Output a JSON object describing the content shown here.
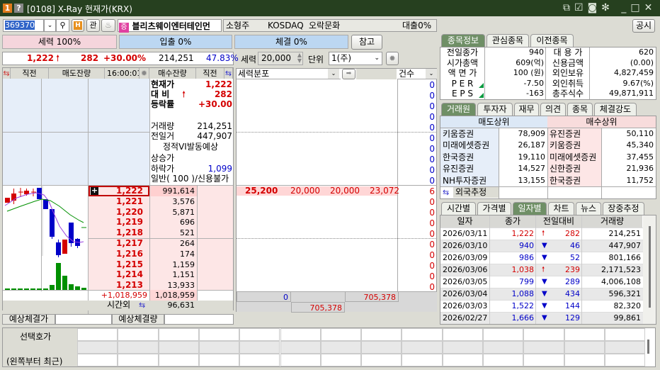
{
  "window": {
    "badge": "1",
    "help": "?",
    "title": "[0108] X-Ray 현재가(KRX)",
    "colors": {
      "titlebar": "#26401f"
    }
  },
  "toolbar": {
    "code": "369370",
    "h_label": "H",
    "watch_label": "관",
    "name_badge": "증",
    "stock_name": "블리츠웨이엔터테인먼",
    "size": "소형주",
    "market": "KOSDAQ",
    "sector": "오락문화",
    "loan": "대출0%",
    "notice": "공시"
  },
  "ratios": {
    "force": "세력 100%",
    "inout": "입출 0%",
    "trade": "체결 0%",
    "ref": "참고"
  },
  "quote": {
    "price": "1,222",
    "change": "282",
    "rate": "+30.00%",
    "volume": "214,251",
    "ratio": "47.83%"
  },
  "force_ctrl": {
    "label": "세력",
    "value": "20,000",
    "unit_label": "단위",
    "unit": "1(주)"
  },
  "orderbook": {
    "headers": {
      "prev": "직전",
      "ask_qty": "매도잔량",
      "time": "16:00:01",
      "bid_qty": "매수잔량",
      "prev2": "직전"
    },
    "info": {
      "cur_label": "현재가",
      "cur": "1,222",
      "diff_label": "대 비",
      "diff": "282",
      "rate_label": "등락률",
      "rate": "+30.00",
      "vol_label": "거래량",
      "vol": "214,251",
      "prevvol_label": "전일거",
      "prevvol": "447,907",
      "vi": "정적VI발동예상",
      "up_label": "상승가",
      "down_label": "하락가",
      "down": "1,099",
      "credit": "일반( 100 )/신용불가"
    },
    "bids": [
      {
        "price": "1,222",
        "qty": "991,614"
      },
      {
        "price": "1,221",
        "qty": "3,576"
      },
      {
        "price": "1,220",
        "qty": "5,871"
      },
      {
        "price": "1,219",
        "qty": "696"
      },
      {
        "price": "1,218",
        "qty": "521"
      },
      {
        "price": "1,217",
        "qty": "264"
      },
      {
        "price": "1,216",
        "qty": "174"
      },
      {
        "price": "1,215",
        "qty": "1,159"
      },
      {
        "price": "1,214",
        "qty": "1,151"
      },
      {
        "price": "1,213",
        "qty": "13,933"
      }
    ],
    "total_change": "+1,018,959",
    "total_bid": "1,018,959",
    "after_label": "시간외",
    "after_qty": "96,631"
  },
  "expected": {
    "price_label": "예상체결가",
    "qty_label": "예상체결량"
  },
  "distribution": {
    "select": "세력분포",
    "count_label": "건수",
    "counts_top": [
      "0",
      "0",
      "0",
      "0",
      "0",
      "0",
      "0",
      "0",
      "0",
      "0"
    ],
    "row": {
      "price": "25,200",
      "a": "20,000",
      "b": "20,000",
      "c": "23,072"
    },
    "counts_bottom": [
      "6",
      "0",
      "0",
      "0",
      "0",
      "0",
      "0",
      "0",
      "0",
      "0"
    ],
    "footer_left": "0",
    "footer_right": "705,378",
    "footer_mid": "705,378"
  },
  "stock_tabs": [
    "종목정보",
    "관심종목",
    "이전종목"
  ],
  "stock_info": [
    {
      "l1": "전일종가",
      "v1": "940",
      "l2": "대 용 가",
      "v2": "620"
    },
    {
      "l1": "시가총액",
      "v1": "609(억)",
      "l2": "신용금액",
      "v2": "(0.00)"
    },
    {
      "l1": "액 면 가",
      "v1": "100 (원)",
      "l2": "외인보유",
      "v2": "4,827,459"
    },
    {
      "l1": "P E R",
      "v1": "-7.50",
      "l2": "외인취득",
      "v2": "9.67(%)"
    },
    {
      "l1": "E P S",
      "v1": "-163",
      "l2": "총주식수",
      "v2": "49,871,911"
    }
  ],
  "broker_tabs": [
    "거래원",
    "투자자",
    "재무",
    "의견",
    "종목",
    "체결강도"
  ],
  "brokers": {
    "sell_header": "매도상위",
    "buy_header": "매수상위",
    "rows": [
      {
        "s": "키움증권",
        "sq": "78,909",
        "b": "유진증권",
        "bq": "50,110"
      },
      {
        "s": "미래에셋증권",
        "sq": "26,187",
        "b": "키움증권",
        "bq": "45,340"
      },
      {
        "s": "한국증권",
        "sq": "19,110",
        "b": "미래에셋증권",
        "bq": "37,455"
      },
      {
        "s": "유진증권",
        "sq": "14,527",
        "b": "신한증권",
        "bq": "21,936"
      },
      {
        "s": "NH투자증권",
        "sq": "13,155",
        "b": "한국증권",
        "bq": "11,752"
      }
    ],
    "foreign": "외국추정"
  },
  "daily_tabs": [
    "시간별",
    "가격별",
    "일자별",
    "차트",
    "뉴스",
    "장중추정"
  ],
  "daily": {
    "headers": [
      "일자",
      "종가",
      "전일대비",
      "거래량"
    ],
    "rows": [
      {
        "date": "2026/03/11",
        "close": "1,222",
        "dir": "up",
        "chg": "282",
        "vol": "214,251"
      },
      {
        "date": "2026/03/10",
        "close": "940",
        "dir": "down",
        "chg": "46",
        "vol": "447,907"
      },
      {
        "date": "2026/03/09",
        "close": "986",
        "dir": "down",
        "chg": "52",
        "vol": "801,166"
      },
      {
        "date": "2026/03/06",
        "close": "1,038",
        "dir": "up",
        "chg": "239",
        "vol": "2,171,523"
      },
      {
        "date": "2026/03/05",
        "close": "799",
        "dir": "down",
        "chg": "289",
        "vol": "4,006,108"
      },
      {
        "date": "2026/03/04",
        "close": "1,088",
        "dir": "down",
        "chg": "434",
        "vol": "596,321"
      },
      {
        "date": "2026/03/03",
        "close": "1,522",
        "dir": "down",
        "chg": "144",
        "vol": "82,320"
      },
      {
        "date": "2026/02/27",
        "close": "1,666",
        "dir": "down",
        "chg": "129",
        "vol": "99,861"
      }
    ]
  },
  "bottom": {
    "label1": "선택호가",
    "label2": "(왼쪽부터 최근)"
  }
}
